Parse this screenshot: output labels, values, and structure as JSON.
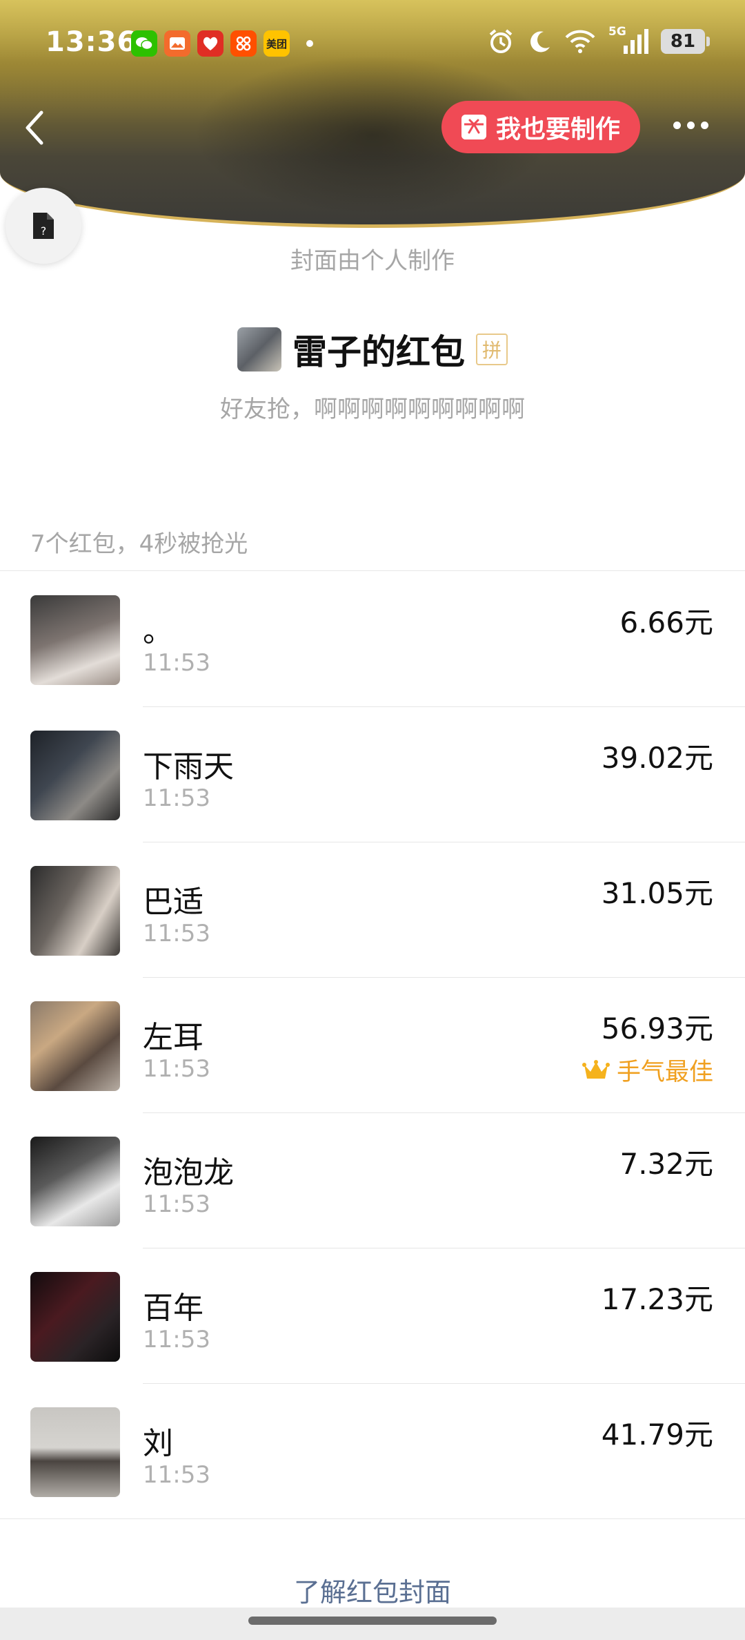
{
  "status_bar": {
    "time": "13:36",
    "app_icons": [
      {
        "name": "wechat-icon",
        "color": "#2dc100",
        "label": ""
      },
      {
        "name": "photos-app-icon",
        "color": "#f36b2c",
        "label": ""
      },
      {
        "name": "pinduoduo-icon",
        "color": "#e02e24",
        "label": ""
      },
      {
        "name": "taobao-special-icon",
        "color": "#ff5000",
        "label": ""
      },
      {
        "name": "meituan-icon",
        "color": "#ffc300",
        "label": "美团"
      }
    ],
    "battery": "81",
    "network": "5G"
  },
  "header": {
    "make_button_label": "我也要制作",
    "accent_color": "#f04a55"
  },
  "cover_note": "封面由个人制作",
  "packet": {
    "title": "雷子的红包",
    "pin_badge": "拼",
    "greeting": "好友抢，啊啊啊啊啊啊啊啊啊"
  },
  "summary": "7个红包，4秒被抢光",
  "recipients": [
    {
      "name": "。",
      "time": "11:53",
      "amount": "6.66元"
    },
    {
      "name": "下雨天",
      "time": "11:53",
      "amount": "39.02元"
    },
    {
      "name": "巴适",
      "time": "11:53",
      "amount": "31.05元"
    },
    {
      "name": "左耳",
      "time": "11:53",
      "amount": "56.93元",
      "best_label": "手气最佳"
    },
    {
      "name": "泡泡龙",
      "time": "11:53",
      "amount": "7.32元"
    },
    {
      "name": "百年",
      "time": "11:53",
      "amount": "17.23元"
    },
    {
      "name": "刘",
      "time": "11:53",
      "amount": "41.79元"
    }
  ],
  "learn_link": "了解红包封面"
}
